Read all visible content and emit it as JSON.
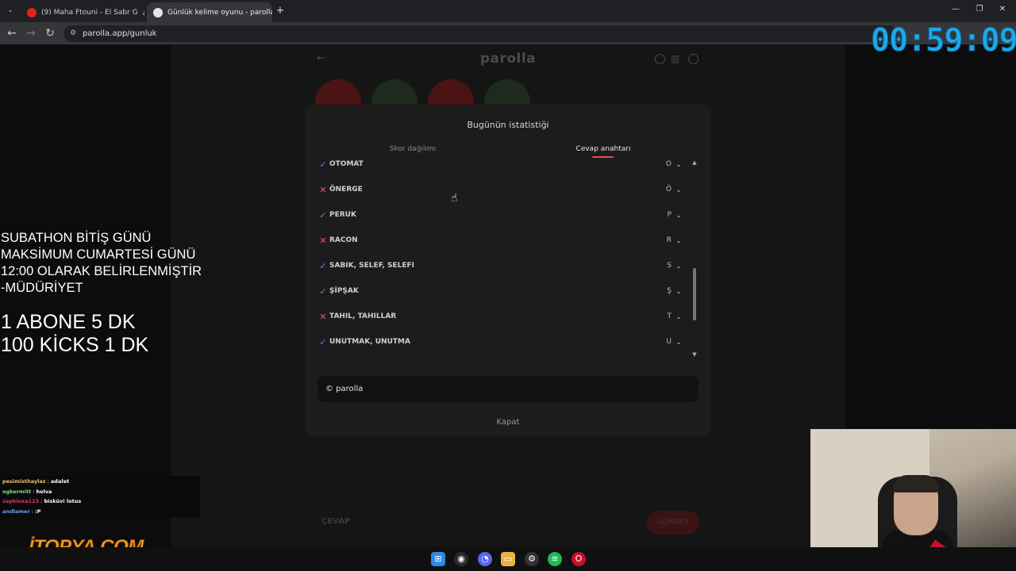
{
  "browser": {
    "tabs": [
      {
        "title": "(9) Maha Ftouni - El Sabr G",
        "icon": "youtube-icon",
        "active": false
      },
      {
        "title": "Günlük kelime oyunu - parolla",
        "icon": "parolla-icon",
        "active": true
      }
    ],
    "new_tab": "+",
    "url": "parolla.app/gunluk"
  },
  "game": {
    "title": "parolla",
    "input_placeholder": "ÇEVAP",
    "submit_label": "GÖNDER"
  },
  "modal": {
    "title": "Bugünün istatistiği",
    "tabs": [
      {
        "label": "Skor dağılımı",
        "active": false
      },
      {
        "label": "Cevap anahtarı",
        "active": true
      }
    ],
    "answers": [
      {
        "word": "OTOMAT",
        "letter": "O",
        "correct": true
      },
      {
        "word": "ÖNERGE",
        "letter": "Ö",
        "correct": false
      },
      {
        "word": "PERUK",
        "letter": "P",
        "correct": true
      },
      {
        "word": "RACON",
        "letter": "R",
        "correct": false
      },
      {
        "word": "SABIK, SELEF, SELEFI",
        "letter": "S",
        "correct": true
      },
      {
        "word": "ŞİPŞAK",
        "letter": "Ş",
        "correct": true
      },
      {
        "word": "TAHIL, TAHILLAR",
        "letter": "T",
        "correct": false
      },
      {
        "word": "UNUTMAK, UNUTMA",
        "letter": "U",
        "correct": true
      }
    ],
    "share_text": "© parolla",
    "close_label": "Kapat"
  },
  "overlay": {
    "timer": "00:59:09",
    "notice_lines": [
      "SUBATHON BİTİŞ GÜNÜ",
      "MAKSİMUM CUMARTESİ GÜNÜ",
      "12:00 OLARAK BELİRLENMİŞTİR",
      "-MÜDÜRİYET"
    ],
    "rate_lines": [
      "1 ABONE 5 DK",
      "100 KİCKS  1 DK"
    ],
    "chat": [
      {
        "user": "pesimisthaylaz",
        "message": "adalet",
        "color": "#e8c46a"
      },
      {
        "user": "ogkermitt",
        "message": "helva",
        "color": "#7ee07a"
      },
      {
        "user": "zapkinxa123",
        "message": "bisküvi lotus",
        "color": "#d03a6a"
      },
      {
        "user": "andlamer",
        "message": ":P",
        "color": "#6aa0ff"
      }
    ],
    "sponsor": "İTOPYA.COM"
  },
  "colors": {
    "correct": "#8a6cff",
    "wrong": "#ff4d6a",
    "accent": "#e84a5f",
    "timer": "#1ea8e6"
  }
}
